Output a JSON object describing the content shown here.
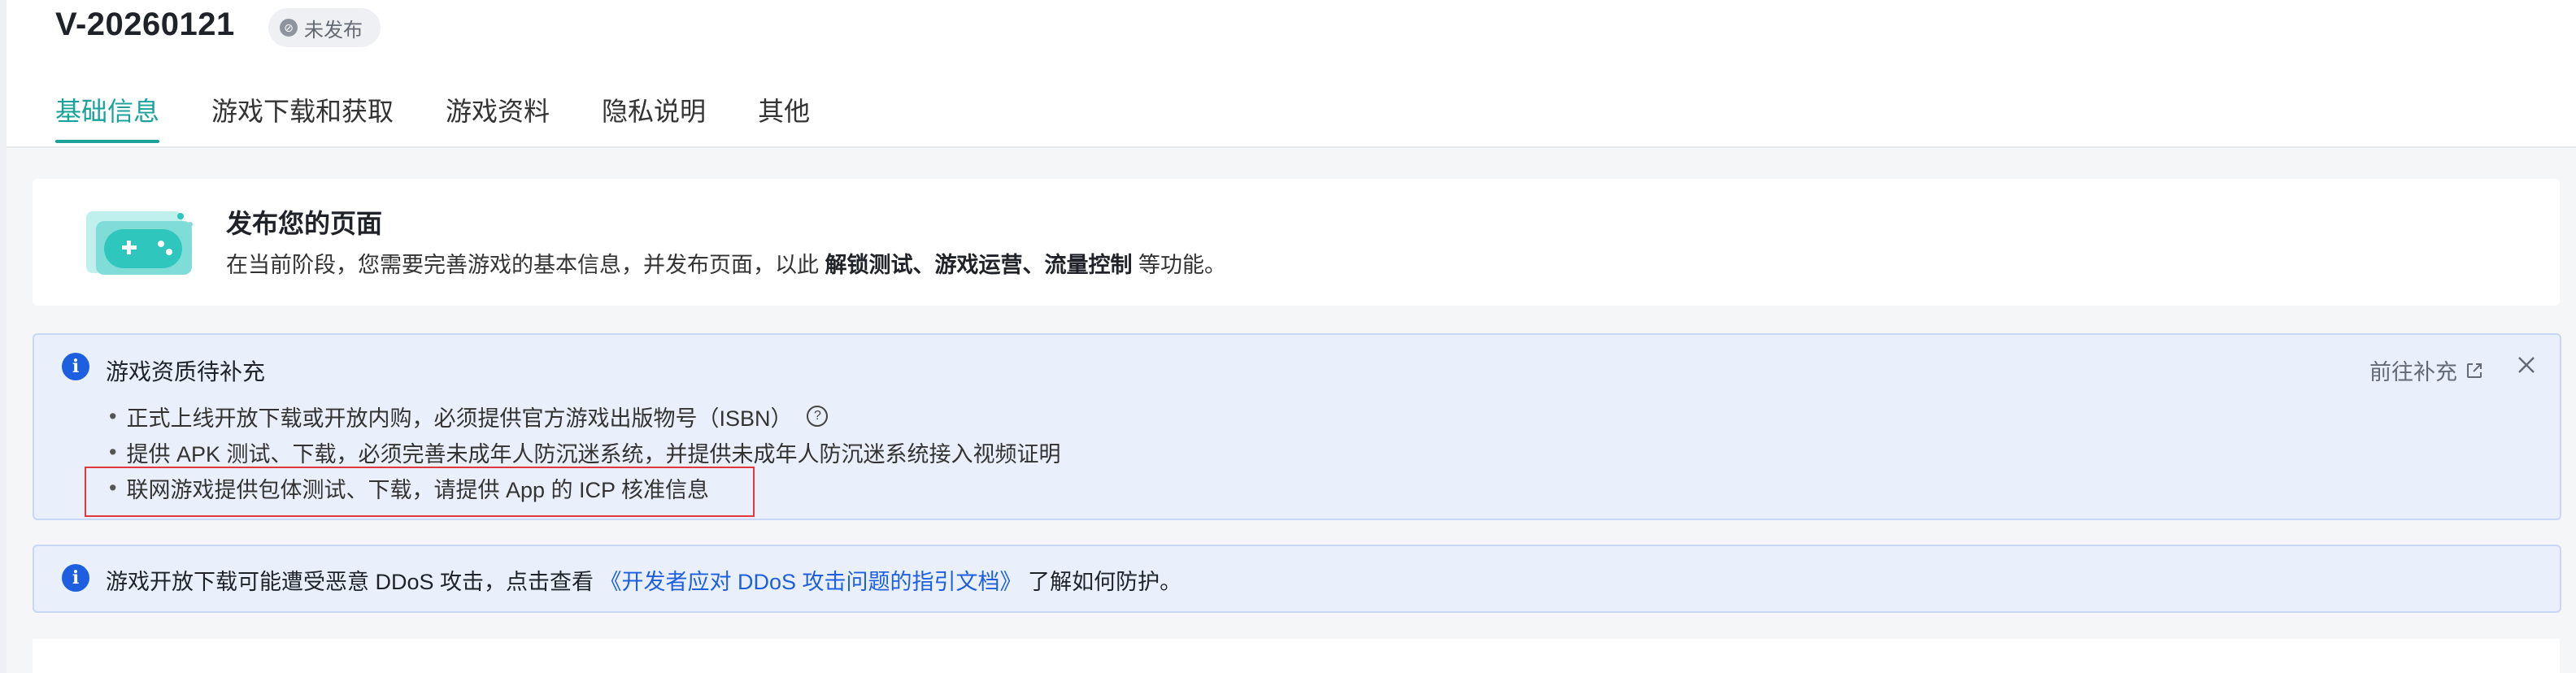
{
  "header": {
    "version": "V-20260121",
    "status_badge": "未发布",
    "tabs": [
      {
        "label": "基础信息",
        "active": true
      },
      {
        "label": "游戏下载和获取",
        "active": false
      },
      {
        "label": "游戏资料",
        "active": false
      },
      {
        "label": "隐私说明",
        "active": false
      },
      {
        "label": "其他",
        "active": false
      }
    ]
  },
  "publish": {
    "title": "发布您的页面",
    "desc_prefix": "在当前阶段，您需要完善游戏的基本信息，并发布页面，以此 ",
    "desc_bold": "解锁测试、游戏运营、流量控制",
    "desc_suffix": " 等功能。"
  },
  "qualification_alert": {
    "title": "游戏资质待补充",
    "goto_label": "前往补充",
    "items": [
      "正式上线开放下载或开放内购，必须提供官方游戏出版物号（ISBN）",
      "提供 APK 测试、下载，必须完善未成年人防沉迷系统，并提供未成年人防沉迷系统接入视频证明",
      "联网游戏提供包体测试、下载，请提供 App 的 ICP 核准信息"
    ]
  },
  "ddos_alert": {
    "prefix": "游戏开放下载可能遭受恶意 DDoS 攻击，点击查看 ",
    "link": "《开发者应对 DDoS 攻击问题的指引文档》",
    "suffix": " 了解如何防护。"
  },
  "colors": {
    "accent": "#1aa39b",
    "info_blue": "#1d5fe0",
    "alert_bg": "#eaf0fb",
    "highlight_red": "#e0383e"
  }
}
